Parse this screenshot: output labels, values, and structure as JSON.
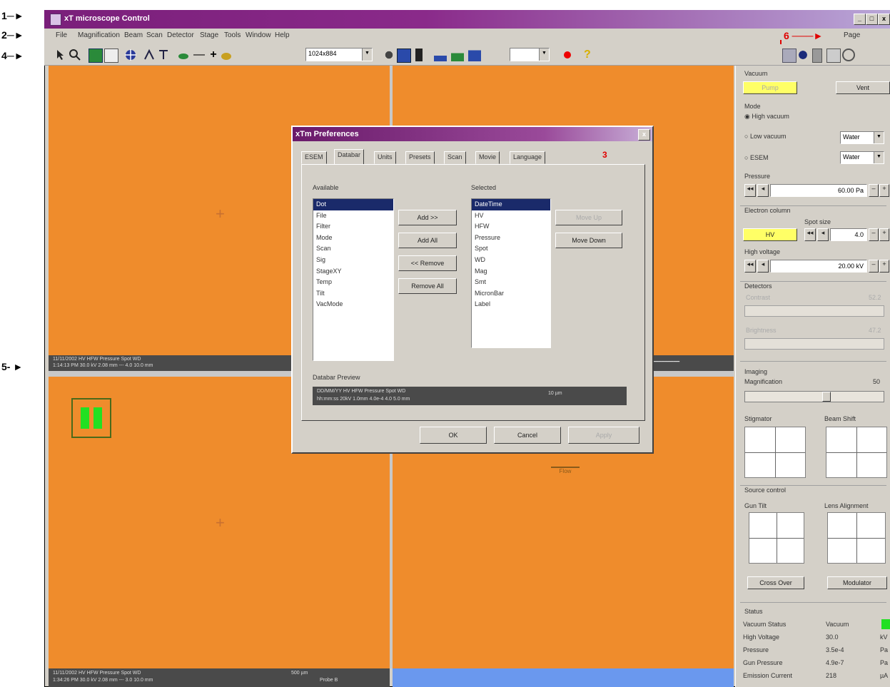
{
  "callouts": [
    "1",
    "2",
    "4",
    "5",
    "6",
    "3"
  ],
  "window": {
    "title": "xT microscope Control",
    "page_label": "Page"
  },
  "menu": [
    "File",
    "Magnification",
    "Beam",
    "Scan",
    "Detector",
    "Stage",
    "Tools",
    "Window",
    "Help"
  ],
  "toolbar": {
    "resolution": "1024x884"
  },
  "quads": {
    "top_left": {
      "databar": [
        "11/11/2002  HV  HFW  Pressure  Spot  WD",
        "1:14:13 PM  30.0 kV  2.08 mm  ---  4.0  10.0 mm"
      ]
    },
    "bottom_left": {
      "databar": [
        "11/11/2002  HV  HFW  Pressure  Spot  WD",
        "1:34:26 PM  30.0 kV  2.08 mm  ---  3.0  10.0 mm"
      ],
      "scalebar": "500 µm",
      "detector": "Probe B"
    },
    "bottom_right": {
      "marker_label": "Flow"
    }
  },
  "panel": {
    "vacuum": {
      "title": "Vacuum",
      "pump": "Pump",
      "vent": "Vent"
    },
    "mode": {
      "title": "Mode",
      "high": "High vacuum",
      "low": "Low vacuum",
      "esem": "ESEM",
      "gas1": "Water",
      "gas2": "Water"
    },
    "pressure": {
      "title": "Pressure",
      "value": "60.00 Pa"
    },
    "column": {
      "title": "Electron column",
      "spot_label": "Spot size",
      "hv_button": "HV",
      "spot_value": "4.0",
      "hv_title": "High voltage",
      "hv_value": "20.00 kV"
    },
    "detectors": {
      "title": "Detectors",
      "contrast": "Contrast",
      "brightness": "Brightness",
      "contrast_value": "52.2",
      "brightness_value": "47.2"
    },
    "imaging": {
      "title": "Imaging",
      "magnification": "Magnification",
      "mag_value": "50",
      "stigmator": "Stigmator",
      "beam_shift": "Beam Shift"
    },
    "source": {
      "title": "Source control",
      "gun_tilt": "Gun Tilt",
      "lens_align": "Lens Alignment",
      "crossover": "Cross Over",
      "modulator": "Modulator"
    },
    "status": {
      "title": "Status",
      "rows": [
        {
          "label": "Vacuum Status",
          "value": "Vacuum",
          "unit": ""
        },
        {
          "label": "High Voltage",
          "value": "30.0",
          "unit": "kV"
        },
        {
          "label": "Pressure",
          "value": "3.5e-4",
          "unit": "Pa"
        },
        {
          "label": "Gun Pressure",
          "value": "4.9e-7",
          "unit": "Pa"
        },
        {
          "label": "Emission Current",
          "value": "218",
          "unit": "µA"
        }
      ]
    }
  },
  "dialog": {
    "title": "xTm Preferences",
    "tabs": [
      "ESEM",
      "Databar",
      "Units",
      "Presets",
      "Scan",
      "Movie",
      "Language"
    ],
    "available_label": "Available",
    "selected_label": "Selected",
    "available": [
      "Dot",
      "File",
      "Filter",
      "Mode",
      "Scan",
      "Sig",
      "StageXY",
      "Temp",
      "Tilt",
      "VacMode"
    ],
    "selected": [
      "DateTime",
      "HV",
      "HFW",
      "Pressure",
      "Spot",
      "WD",
      "Mag",
      "Smt",
      "MicronBar",
      "Label"
    ],
    "buttons": {
      "add": "Add >>",
      "add_all": "Add All",
      "remove": "<< Remove",
      "remove_all": "Remove All",
      "move_up": "Move Up",
      "move_down": "Move Down"
    },
    "preview_label": "Databar Preview",
    "preview": [
      "DD/MM/YY  HV  HFW  Pressure  Spot  WD",
      "hh:mm:ss  20kV  1.0mm  4.0e-4  4.0  5.0 mm"
    ],
    "preview_scale": "10 µm",
    "ok": "OK",
    "cancel": "Cancel",
    "apply": "Apply"
  },
  "colors": {
    "viewport": "#ef8c2c",
    "titlebar": "#7a1f7a",
    "accent_yellow": "#ffff66",
    "status_ok": "#22e022"
  }
}
